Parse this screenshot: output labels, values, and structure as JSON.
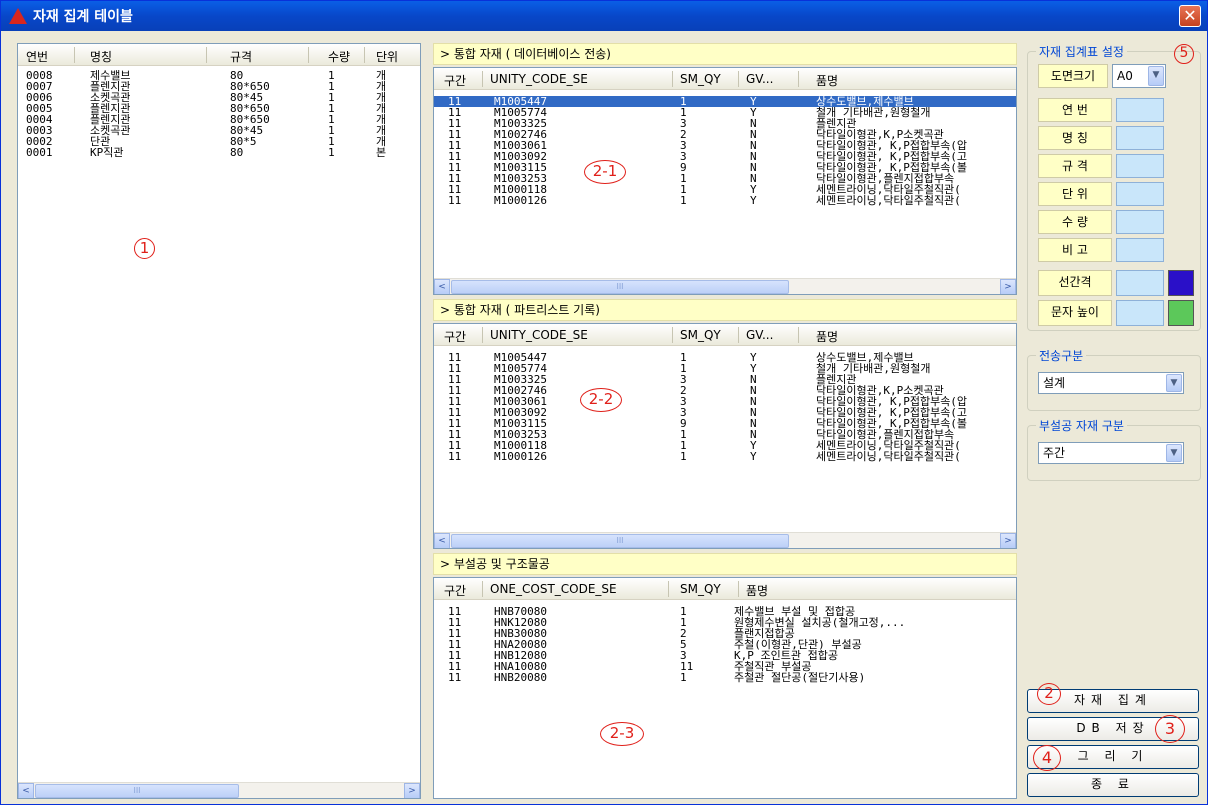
{
  "window": {
    "title": "자재 집계 테이블",
    "close_glyph": "✕"
  },
  "left_table": {
    "headers": [
      "연번",
      "명칭",
      "규격",
      "수량",
      "단위"
    ],
    "rows": [
      [
        "0008",
        "제수밸브",
        "80",
        "1",
        "개"
      ],
      [
        "0007",
        "플렌지관",
        "80*650",
        "1",
        "개"
      ],
      [
        "0006",
        "소켓곡관",
        "80*45",
        "1",
        "개"
      ],
      [
        "0005",
        "플렌지관",
        "80*650",
        "1",
        "개"
      ],
      [
        "0004",
        "플렌지관",
        "80*650",
        "1",
        "개"
      ],
      [
        "0003",
        "소켓곡관",
        "80*45",
        "1",
        "개"
      ],
      [
        "0002",
        "단관",
        "80*5",
        "1",
        "개"
      ],
      [
        "0001",
        "KP직관",
        "80",
        "1",
        "본"
      ]
    ]
  },
  "section1": {
    "title": "> 통합 자재 ( 데이터베이스 전송)",
    "headers": [
      "구간",
      "UNITY_CODE_SE",
      "SM_QY",
      "GV...",
      "품명"
    ],
    "rows": [
      [
        "11",
        "M1005447",
        "1",
        "Y",
        "상수도밸브,제수밸브"
      ],
      [
        "11",
        "M1005774",
        "1",
        "Y",
        "철개 기타배관,원형철개"
      ],
      [
        "11",
        "M1003325",
        "3",
        "N",
        "플렌지관"
      ],
      [
        "11",
        "M1002746",
        "2",
        "N",
        "닥타일이형관,K,P소켓곡관"
      ],
      [
        "11",
        "M1003061",
        "3",
        "N",
        "닥타일이형관, K,P접합부속(압"
      ],
      [
        "11",
        "M1003092",
        "3",
        "N",
        "닥타일이형관, K,P접합부속(고"
      ],
      [
        "11",
        "M1003115",
        "9",
        "N",
        "닥타일이형관, K,P접합부속(볼"
      ],
      [
        "11",
        "M1003253",
        "1",
        "N",
        "닥타일이형관,플렌지접합부속"
      ],
      [
        "11",
        "M1000118",
        "1",
        "Y",
        "세멘트라이닝,닥타일주철직관("
      ],
      [
        "11",
        "M1000126",
        "1",
        "Y",
        "세멘트라이닝,닥타일주철직관("
      ]
    ]
  },
  "section2": {
    "title": "> 통합 자재 ( 파트리스트 기록)",
    "headers": [
      "구간",
      "UNITY_CODE_SE",
      "SM_QY",
      "GV...",
      "품명"
    ],
    "rows": [
      [
        "11",
        "M1005447",
        "1",
        "Y",
        "상수도밸브,제수밸브"
      ],
      [
        "11",
        "M1005774",
        "1",
        "Y",
        "철개 기타배관,원형철개"
      ],
      [
        "11",
        "M1003325",
        "3",
        "N",
        "플렌지관"
      ],
      [
        "11",
        "M1002746",
        "2",
        "N",
        "닥타일이형관,K,P소켓곡관"
      ],
      [
        "11",
        "M1003061",
        "3",
        "N",
        "닥타일이형관, K,P접합부속(압"
      ],
      [
        "11",
        "M1003092",
        "3",
        "N",
        "닥타일이형관, K,P접합부속(고"
      ],
      [
        "11",
        "M1003115",
        "9",
        "N",
        "닥타일이형관, K,P접합부속(볼"
      ],
      [
        "11",
        "M1003253",
        "1",
        "N",
        "닥타일이형관,플렌지접합부속"
      ],
      [
        "11",
        "M1000118",
        "1",
        "Y",
        "세멘트라이닝,닥타일주철직관("
      ],
      [
        "11",
        "M1000126",
        "1",
        "Y",
        "세멘트라이닝,닥타일주철직관("
      ]
    ]
  },
  "section3": {
    "title": "> 부설공 및 구조물공",
    "headers": [
      "구간",
      "ONE_COST_CODE_SE",
      "SM_QY",
      "품명"
    ],
    "rows": [
      [
        "11",
        "HNB70080",
        "1",
        "제수밸브 부설 및 접합공"
      ],
      [
        "11",
        "HNK12080",
        "1",
        "원형제수변실 설치공(철개고정,..."
      ],
      [
        "11",
        "HNB30080",
        "2",
        "플랜지접합공"
      ],
      [
        "11",
        "HNA20080",
        "5",
        "주철(이형관,단관) 부설공"
      ],
      [
        "11",
        "HNB12080",
        "3",
        "K,P 조인트관 접합공"
      ],
      [
        "11",
        "HNA10080",
        "11",
        "주철직관 부설공"
      ],
      [
        "11",
        "HNB20080",
        "1",
        "주철관 절단공(절단기사용)"
      ]
    ]
  },
  "settings": {
    "group_title": "자재 집계표 설정",
    "sheet_size_label": "도면크기",
    "sheet_size_value": "A0",
    "fields": [
      "연 번",
      "명 칭",
      "규 격",
      "단 위",
      "수 량",
      "비 고"
    ],
    "line_spacing_label": "선간격",
    "text_height_label": "문자 높이",
    "colors": {
      "line_spacing": "#2A10C8",
      "text_height": "#5CC85A"
    }
  },
  "transfer": {
    "title": "전송구분",
    "value": "설계"
  },
  "category": {
    "title": "부설공 자재 구분",
    "value": "주간"
  },
  "buttons": {
    "aggregate": "자재 집계",
    "db_save": "DB 저장",
    "draw": "그 리 기",
    "close": "종 료"
  },
  "annotations": {
    "a1": "1",
    "a21": "2-1",
    "a22": "2-2",
    "a23": "2-3",
    "a2": "2",
    "a3": "3",
    "a4": "4",
    "a5": "5"
  },
  "scroll": {
    "thumb_glyph": "III",
    "left": "<",
    "right": ">"
  }
}
